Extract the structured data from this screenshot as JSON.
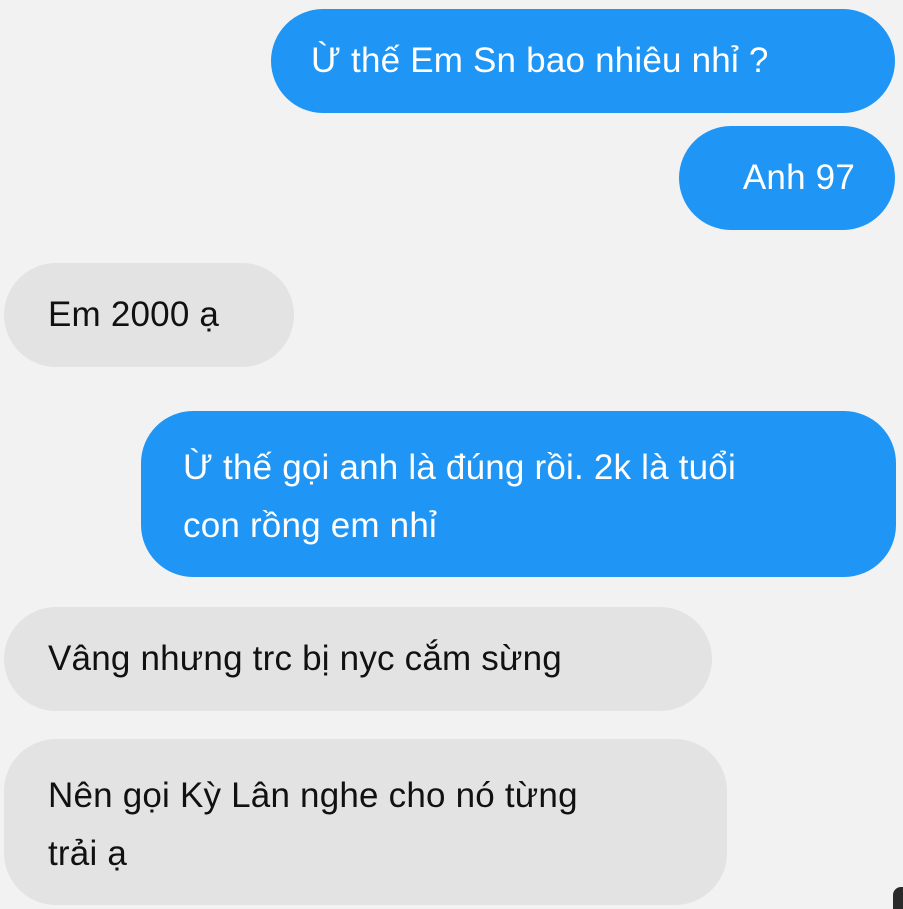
{
  "messages": [
    {
      "sender": "me",
      "text": "Ừ thế Em Sn bao nhiêu nhỉ ?"
    },
    {
      "sender": "me",
      "text": "Anh 97"
    },
    {
      "sender": "other",
      "text": "Em 2000 ạ"
    },
    {
      "sender": "me",
      "text": "Ừ thế gọi anh là đúng rồi. 2k là tuổi\ncon rồng em nhỉ"
    },
    {
      "sender": "other",
      "text": "Vâng nhưng trc bị nyc cắm sừng"
    },
    {
      "sender": "other",
      "text": "Nên gọi Kỳ Lân nghe cho nó từng\ntrải ạ"
    }
  ],
  "colors": {
    "background": "#f2f2f2",
    "outgoing_bubble": "#1f95f5",
    "incoming_bubble": "#e3e3e3"
  }
}
